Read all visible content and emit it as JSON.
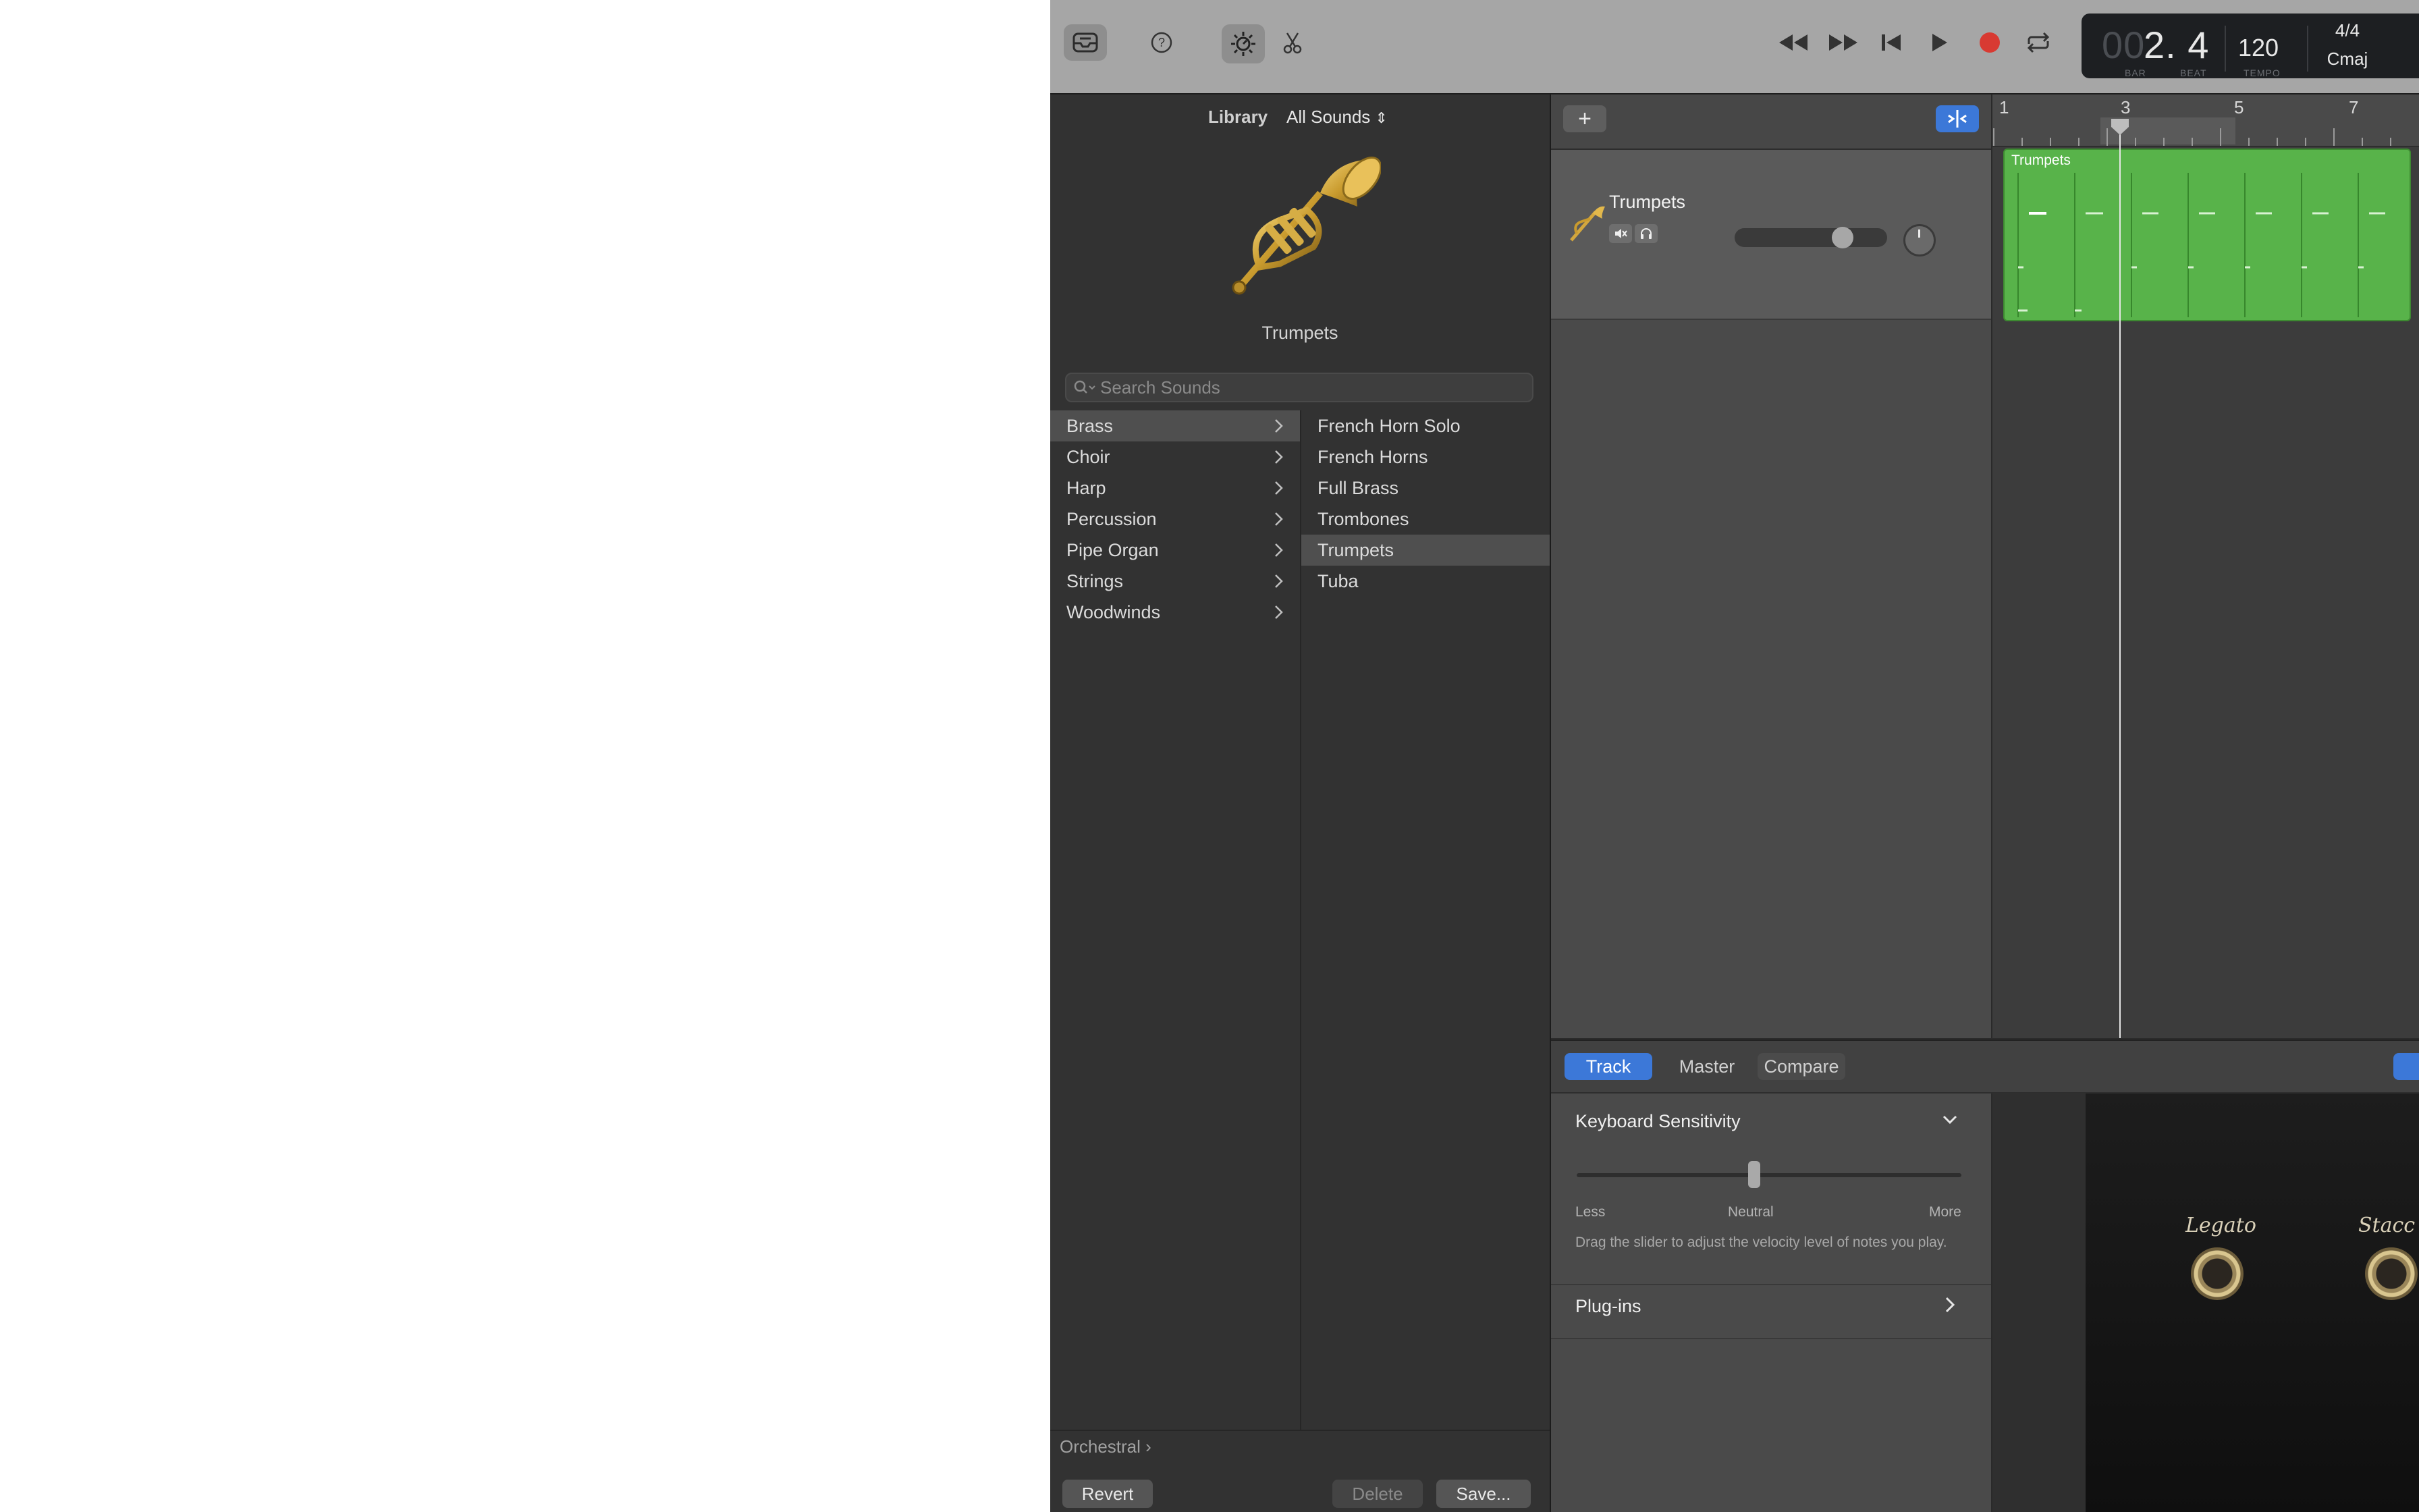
{
  "toolbar": {
    "buttons": [
      "library-icon",
      "help-icon",
      "smart-controls-icon",
      "editors-icon"
    ],
    "transport": [
      "rewind-icon",
      "fast-forward-icon",
      "go-to-beginning-icon",
      "play-icon",
      "record-icon",
      "cycle-icon"
    ],
    "lcd": {
      "bar_prefix": "00",
      "position": "2. 4",
      "bar_caption": "BAR",
      "beat_caption": "BEAT",
      "tempo": "120",
      "tempo_caption": "TEMPO",
      "time_signature": "4/4",
      "key": "Cmaj"
    },
    "record_color": "#d83a32"
  },
  "library": {
    "title": "Library",
    "filter": "All Sounds",
    "selected_sound": "Trumpets",
    "search_placeholder": "Search Sounds",
    "categories": [
      {
        "label": "Brass",
        "selected": true
      },
      {
        "label": "Choir"
      },
      {
        "label": "Harp"
      },
      {
        "label": "Percussion"
      },
      {
        "label": "Pipe Organ"
      },
      {
        "label": "Strings"
      },
      {
        "label": "Woodwinds"
      }
    ],
    "sounds": [
      {
        "label": "French Horn Solo"
      },
      {
        "label": "French Horns"
      },
      {
        "label": "Full Brass"
      },
      {
        "label": "Trombones"
      },
      {
        "label": "Trumpets",
        "selected": true
      },
      {
        "label": "Tuba"
      }
    ],
    "breadcrumb": "Orchestral ›",
    "revert_label": "Revert",
    "delete_label": "Delete",
    "save_label": "Save..."
  },
  "tracks": {
    "add_button": "+",
    "track_name": "Trumpets",
    "ruler": [
      "1",
      "3",
      "5",
      "7"
    ],
    "region_name": "Trumpets",
    "region_color": "#58b34a"
  },
  "editor": {
    "tabs": [
      "Track",
      "Master",
      "Compare"
    ],
    "active_tab": "Track",
    "keyboard_sensitivity": {
      "title": "Keyboard Sensitivity",
      "less": "Less",
      "neutral": "Neutral",
      "more": "More",
      "description": "Drag the slider to adjust the velocity level of notes you play."
    },
    "plugins_label": "Plug-ins",
    "articulations": [
      "Legato",
      "Stacc"
    ]
  }
}
